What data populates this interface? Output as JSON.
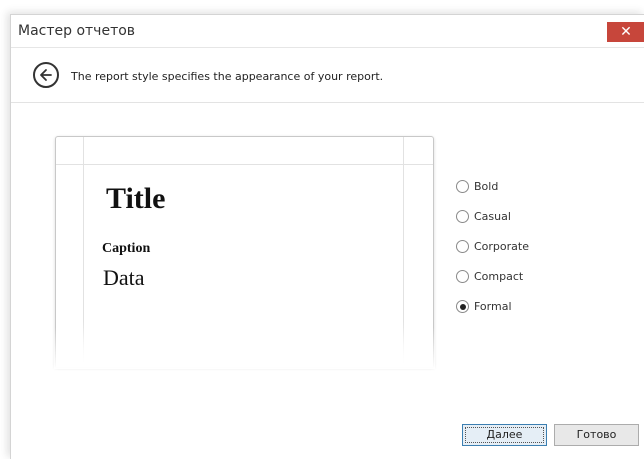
{
  "window": {
    "title": "Мастер отчетов",
    "close_label": "✕"
  },
  "header": {
    "description": "The report style specifies the appearance of your report."
  },
  "preview": {
    "title": "Title",
    "caption": "Caption",
    "data": "Data"
  },
  "styles": {
    "options": [
      {
        "label": "Bold",
        "checked": false
      },
      {
        "label": "Casual",
        "checked": false
      },
      {
        "label": "Corporate",
        "checked": false
      },
      {
        "label": "Compact",
        "checked": false
      },
      {
        "label": "Formal",
        "checked": true
      }
    ],
    "selected": "Formal"
  },
  "footer": {
    "next_label": "Далее",
    "done_label": "Готово"
  },
  "colors": {
    "close_button": "#c7463b",
    "primary_border": "#3c7fb1"
  }
}
